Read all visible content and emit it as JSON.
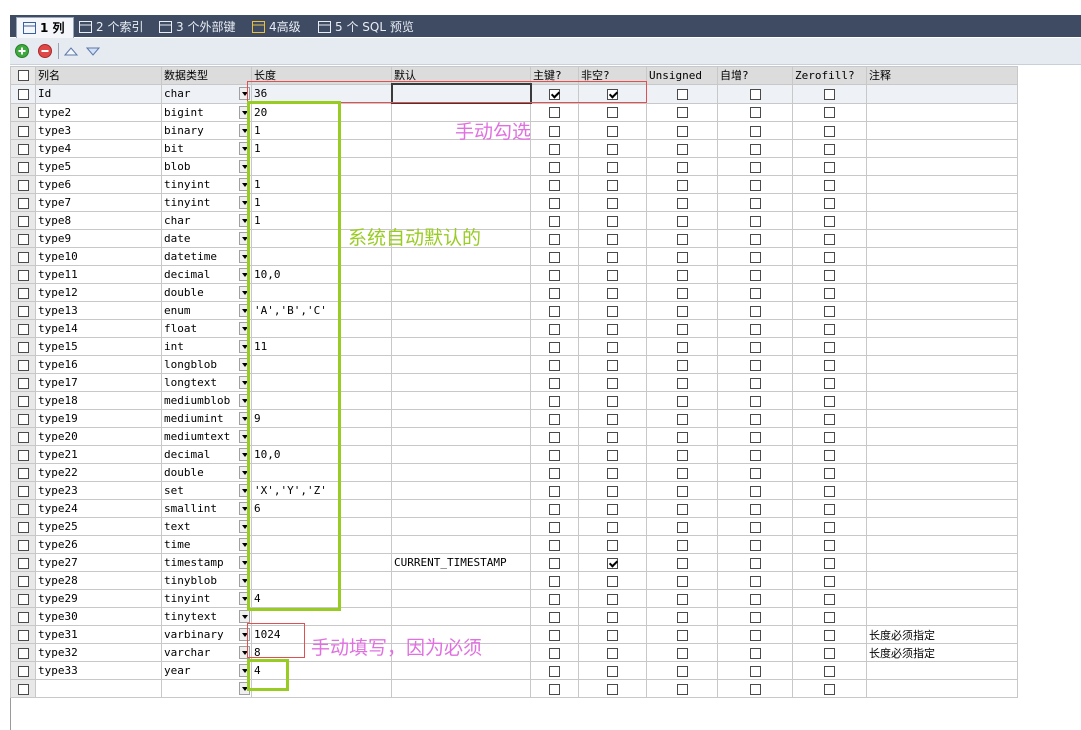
{
  "tabs": [
    {
      "label": "1 列",
      "active": true
    },
    {
      "label": "2 个索引",
      "active": false
    },
    {
      "label": "3 个外部键",
      "active": false
    },
    {
      "label": "4高级",
      "active": false
    },
    {
      "label": "5 个 SQL 预览",
      "active": false
    }
  ],
  "toolbar": {
    "add": "add-icon",
    "delete": "delete-icon",
    "move_up": "move-up-icon",
    "move_down": "move-down-icon"
  },
  "columns": {
    "name": "列名",
    "type": "数据类型",
    "length": "长度",
    "default": "默认",
    "pk": "主键?",
    "notnull": "非空?",
    "unsigned": "Unsigned",
    "autoinc": "自增?",
    "zerofill": "Zerofill?",
    "comment": "注释"
  },
  "rows": [
    {
      "name": "Id",
      "type": "char",
      "length": "36",
      "default": "",
      "pk": true,
      "notnull": true,
      "comment": ""
    },
    {
      "name": "type2",
      "type": "bigint",
      "length": "20",
      "default": "",
      "pk": false,
      "notnull": false,
      "comment": ""
    },
    {
      "name": "type3",
      "type": "binary",
      "length": "1",
      "default": "",
      "pk": false,
      "notnull": false,
      "comment": ""
    },
    {
      "name": "type4",
      "type": "bit",
      "length": "1",
      "default": "",
      "pk": false,
      "notnull": false,
      "comment": ""
    },
    {
      "name": "type5",
      "type": "blob",
      "length": "",
      "default": "",
      "pk": false,
      "notnull": false,
      "comment": ""
    },
    {
      "name": "type6",
      "type": "tinyint",
      "length": "1",
      "default": "",
      "pk": false,
      "notnull": false,
      "comment": ""
    },
    {
      "name": "type7",
      "type": "tinyint",
      "length": "1",
      "default": "",
      "pk": false,
      "notnull": false,
      "comment": ""
    },
    {
      "name": "type8",
      "type": "char",
      "length": "1",
      "default": "",
      "pk": false,
      "notnull": false,
      "comment": ""
    },
    {
      "name": "type9",
      "type": "date",
      "length": "",
      "default": "",
      "pk": false,
      "notnull": false,
      "comment": ""
    },
    {
      "name": "type10",
      "type": "datetime",
      "length": "",
      "default": "",
      "pk": false,
      "notnull": false,
      "comment": ""
    },
    {
      "name": "type11",
      "type": "decimal",
      "length": "10,0",
      "default": "",
      "pk": false,
      "notnull": false,
      "comment": ""
    },
    {
      "name": "type12",
      "type": "double",
      "length": "",
      "default": "",
      "pk": false,
      "notnull": false,
      "comment": ""
    },
    {
      "name": "type13",
      "type": "enum",
      "length": "'A','B','C'",
      "default": "",
      "pk": false,
      "notnull": false,
      "comment": ""
    },
    {
      "name": "type14",
      "type": "float",
      "length": "",
      "default": "",
      "pk": false,
      "notnull": false,
      "comment": ""
    },
    {
      "name": "type15",
      "type": "int",
      "length": "11",
      "default": "",
      "pk": false,
      "notnull": false,
      "comment": ""
    },
    {
      "name": "type16",
      "type": "longblob",
      "length": "",
      "default": "",
      "pk": false,
      "notnull": false,
      "comment": ""
    },
    {
      "name": "type17",
      "type": "longtext",
      "length": "",
      "default": "",
      "pk": false,
      "notnull": false,
      "comment": ""
    },
    {
      "name": "type18",
      "type": "mediumblob",
      "length": "",
      "default": "",
      "pk": false,
      "notnull": false,
      "comment": ""
    },
    {
      "name": "type19",
      "type": "mediumint",
      "length": "9",
      "default": "",
      "pk": false,
      "notnull": false,
      "comment": ""
    },
    {
      "name": "type20",
      "type": "mediumtext",
      "length": "",
      "default": "",
      "pk": false,
      "notnull": false,
      "comment": ""
    },
    {
      "name": "type21",
      "type": "decimal",
      "length": "10,0",
      "default": "",
      "pk": false,
      "notnull": false,
      "comment": ""
    },
    {
      "name": "type22",
      "type": "double",
      "length": "",
      "default": "",
      "pk": false,
      "notnull": false,
      "comment": ""
    },
    {
      "name": "type23",
      "type": "set",
      "length": "'X','Y','Z'",
      "default": "",
      "pk": false,
      "notnull": false,
      "comment": ""
    },
    {
      "name": "type24",
      "type": "smallint",
      "length": "6",
      "default": "",
      "pk": false,
      "notnull": false,
      "comment": ""
    },
    {
      "name": "type25",
      "type": "text",
      "length": "",
      "default": "",
      "pk": false,
      "notnull": false,
      "comment": ""
    },
    {
      "name": "type26",
      "type": "time",
      "length": "",
      "default": "",
      "pk": false,
      "notnull": false,
      "comment": ""
    },
    {
      "name": "type27",
      "type": "timestamp",
      "length": "",
      "default": "CURRENT_TIMESTAMP",
      "pk": false,
      "notnull": true,
      "comment": ""
    },
    {
      "name": "type28",
      "type": "tinyblob",
      "length": "",
      "default": "",
      "pk": false,
      "notnull": false,
      "comment": ""
    },
    {
      "name": "type29",
      "type": "tinyint",
      "length": "4",
      "default": "",
      "pk": false,
      "notnull": false,
      "comment": ""
    },
    {
      "name": "type30",
      "type": "tinytext",
      "length": "",
      "default": "",
      "pk": false,
      "notnull": false,
      "comment": ""
    },
    {
      "name": "type31",
      "type": "varbinary",
      "length": "1024",
      "default": "",
      "pk": false,
      "notnull": false,
      "comment": "长度必须指定"
    },
    {
      "name": "type32",
      "type": "varchar",
      "length": "8",
      "default": "",
      "pk": false,
      "notnull": false,
      "comment": "长度必须指定"
    },
    {
      "name": "type33",
      "type": "year",
      "length": "4",
      "default": "",
      "pk": false,
      "notnull": false,
      "comment": ""
    },
    {
      "name": "",
      "type": "",
      "length": "",
      "default": "",
      "pk": false,
      "notnull": false,
      "comment": ""
    }
  ],
  "annotations": {
    "manual_check": "手动勾选",
    "system_default": "系统自动默认的",
    "manual_fill": "手动填写，因为必须"
  },
  "colors": {
    "annotation_red": "#e05050",
    "annotation_green": "#99cc22",
    "annotation_text_pink": "#e070e0",
    "annotation_text_green": "#99cc22"
  }
}
